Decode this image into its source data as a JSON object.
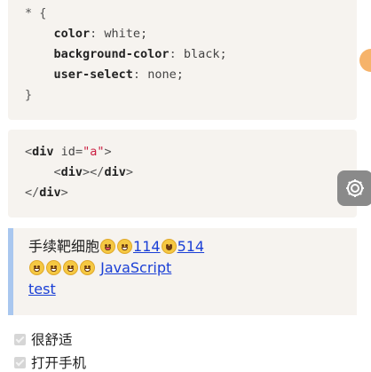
{
  "code_block_1": {
    "lines": [
      {
        "selector": "* {"
      },
      {
        "prop": "color",
        "value": "white;"
      },
      {
        "prop": "background-color",
        "value": "black;"
      },
      {
        "prop": "user-select",
        "value": "none;"
      },
      {
        "close": "}"
      }
    ]
  },
  "code_block_2": {
    "open_tag": "div",
    "attr_name": "id",
    "attr_value": "\"a\"",
    "inner_open": "div",
    "inner_close": "div",
    "close_tag": "div"
  },
  "quote": {
    "text_1": "手续靶细胞",
    "link_1": "114",
    "link_2": "514",
    "link_3": "JavaScript",
    "link_4": "test"
  },
  "checkboxes": [
    {
      "label": "很舒适",
      "checked": true
    },
    {
      "label": "打开手机",
      "checked": true
    }
  ],
  "icons": {
    "settings_fab": "settings-gear-icon",
    "orange_dot": "floating-dot-icon",
    "emojis": [
      "tongue-face-emoji",
      "grin-face-emoji",
      "laugh-face-emoji",
      "grin-face-emoji"
    ]
  },
  "colors": {
    "code_bg": "#f6f3ef",
    "quote_border": "#a9c7ef",
    "link": "#1a3fd6",
    "string": "#cc2244"
  }
}
